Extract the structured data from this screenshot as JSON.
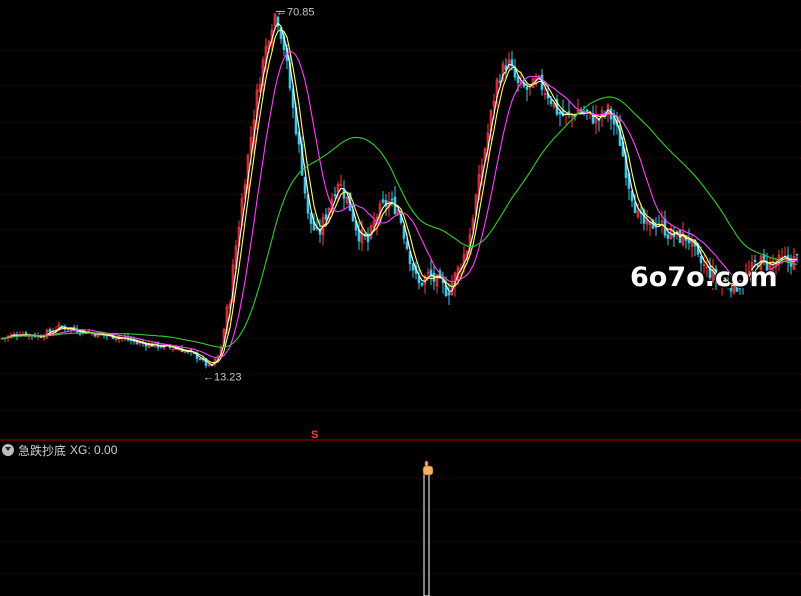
{
  "indicator": {
    "name": "急跌抄底",
    "value_text": "XG: 0.00",
    "signal_marker": "S"
  },
  "watermark": {
    "text": "6o7o.com"
  },
  "annotations": {
    "high_label": "70.85",
    "low_label": "13.23"
  },
  "colors": {
    "up_candle": "#ff3c3c",
    "down_candle": "#3cc8e6",
    "ma_fast": "#ffffff",
    "ma_mid": "#ffff66",
    "ma_slow": "#ff40ff",
    "ma_long": "#33cc33",
    "grid": "#5a0000",
    "divider": "#b40000",
    "text": "#c8c8c8",
    "signal": "#ffffff"
  },
  "chart_data": [
    {
      "type": "candlestick",
      "ylim": [
        10,
        72
      ],
      "y_scale": "log",
      "annotated_high": 70.85,
      "annotated_low": 13.23,
      "ma_legend": [
        "MA fast (white)",
        "MA mid (yellow)",
        "MA slow (magenta)",
        "MA long (green)"
      ],
      "series": [
        {
          "name": "close_path",
          "values": [
            [
              0,
              15.2
            ],
            [
              20,
              15.6
            ],
            [
              40,
              15.4
            ],
            [
              60,
              16.1
            ],
            [
              80,
              15.8
            ],
            [
              100,
              15.5
            ],
            [
              120,
              15.3
            ],
            [
              140,
              14.9
            ],
            [
              160,
              14.7
            ],
            [
              180,
              14.5
            ],
            [
              200,
              13.9
            ],
            [
              210,
              13.23
            ],
            [
              220,
              14.2
            ],
            [
              230,
              18.5
            ],
            [
              240,
              27.0
            ],
            [
              250,
              38.0
            ],
            [
              260,
              52.0
            ],
            [
              270,
              65.0
            ],
            [
              276,
              70.85
            ],
            [
              284,
              60.0
            ],
            [
              292,
              46.0
            ],
            [
              300,
              36.0
            ],
            [
              308,
              27.0
            ],
            [
              318,
              24.5
            ],
            [
              328,
              28.0
            ],
            [
              338,
              32.0
            ],
            [
              348,
              29.0
            ],
            [
              358,
              25.0
            ],
            [
              368,
              24.0
            ],
            [
              378,
              27.5
            ],
            [
              388,
              29.0
            ],
            [
              398,
              28.0
            ],
            [
              408,
              23.0
            ],
            [
              418,
              19.5
            ],
            [
              428,
              20.5
            ],
            [
              438,
              19.8
            ],
            [
              448,
              19.0
            ],
            [
              458,
              21.0
            ],
            [
              468,
              23.5
            ],
            [
              478,
              31.0
            ],
            [
              488,
              40.0
            ],
            [
              498,
              52.0
            ],
            [
              508,
              56.0
            ],
            [
              518,
              50.0
            ],
            [
              528,
              49.0
            ],
            [
              538,
              51.0
            ],
            [
              548,
              48.0
            ],
            [
              558,
              44.0
            ],
            [
              568,
              43.0
            ],
            [
              578,
              44.5
            ],
            [
              588,
              43.5
            ],
            [
              598,
              42.5
            ],
            [
              608,
              44.5
            ],
            [
              618,
              40.0
            ],
            [
              628,
              32.0
            ],
            [
              638,
              27.0
            ],
            [
              648,
              25.5
            ],
            [
              658,
              26.5
            ],
            [
              668,
              25.0
            ],
            [
              678,
              24.5
            ],
            [
              688,
              24.5
            ],
            [
              698,
              22.0
            ],
            [
              708,
              21.0
            ],
            [
              718,
              20.0
            ],
            [
              728,
              19.8
            ],
            [
              738,
              19.5
            ],
            [
              748,
              20.5
            ],
            [
              758,
              22.0
            ],
            [
              768,
              21.5
            ],
            [
              778,
              21.8
            ],
            [
              790,
              22.0
            ],
            [
              800,
              22.1
            ]
          ]
        }
      ]
    },
    {
      "type": "bar",
      "name": "XG",
      "value": 0.0,
      "signal_bars": 1
    }
  ]
}
